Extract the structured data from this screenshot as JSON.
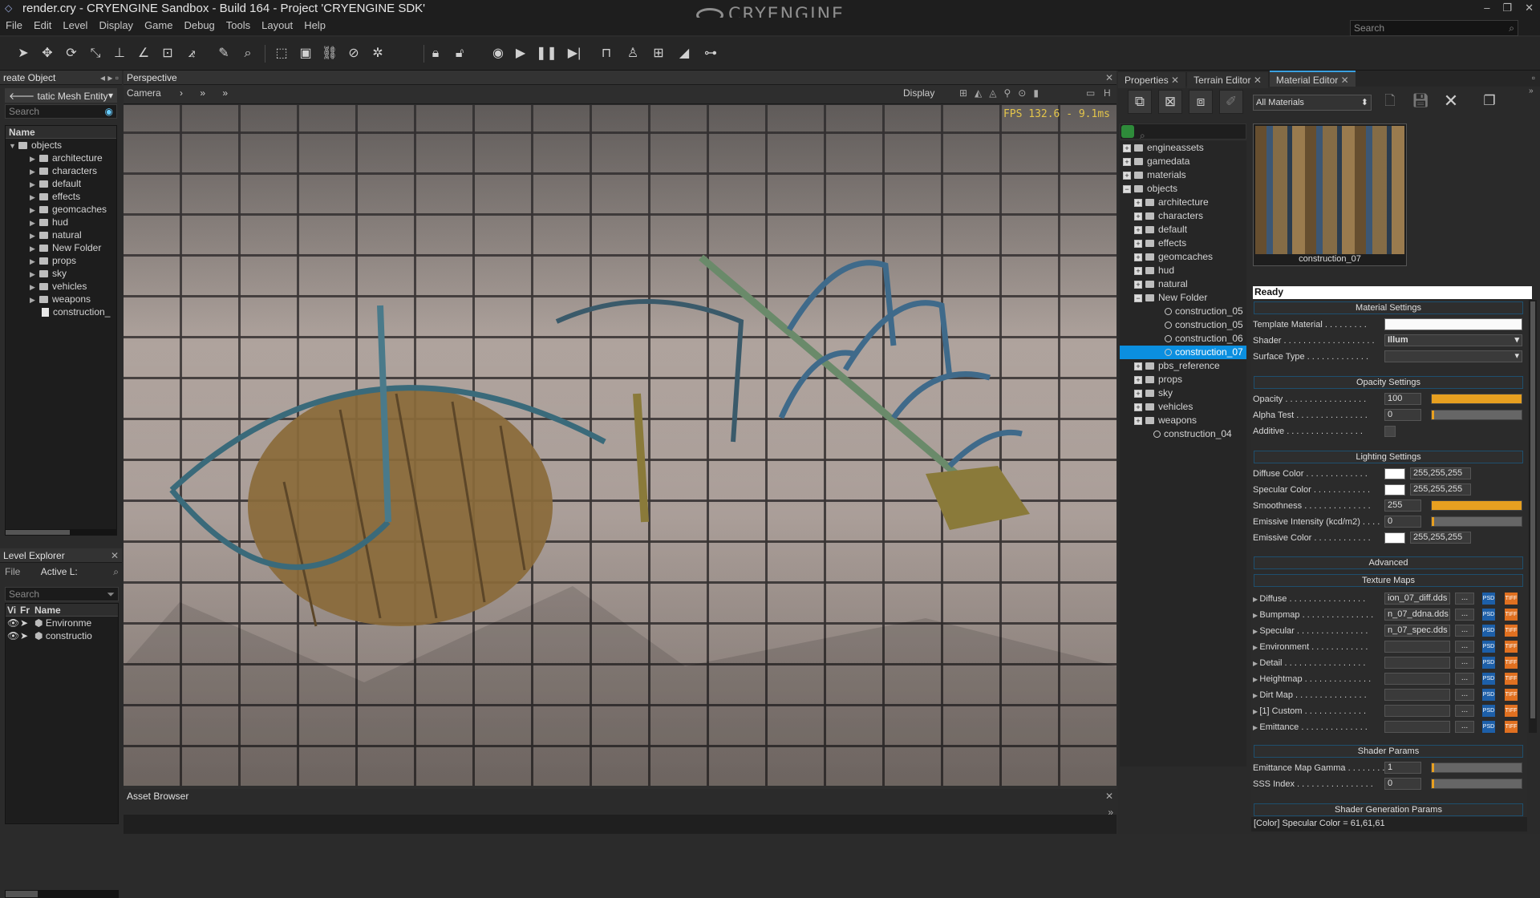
{
  "app": {
    "title": "render.cry - CRYENGINE Sandbox - Build 164 - Project 'CRYENGINE SDK'",
    "logo": "CRYENGINE",
    "search_placeholder": "Search"
  },
  "menu": [
    "File",
    "Edit",
    "Level",
    "Display",
    "Game",
    "Debug",
    "Tools",
    "Layout",
    "Help"
  ],
  "create_object": {
    "title": "reate Object",
    "entity": "tatic Mesh Entity",
    "search": "Search",
    "col": "Name",
    "root": "objects",
    "folders": [
      "architecture",
      "characters",
      "default",
      "effects",
      "geomcaches",
      "hud",
      "natural",
      "New Folder",
      "props",
      "sky",
      "vehicles",
      "weapons"
    ],
    "file": "construction_"
  },
  "level_explorer": {
    "title": "Level Explorer",
    "file_label": "File",
    "active": "Active L:",
    "search": "Search",
    "cols": [
      "Vi",
      "Fr",
      "Name"
    ],
    "rows": [
      "Environme",
      "constructio"
    ]
  },
  "viewport": {
    "title": "Perspective",
    "camera": "Camera",
    "display": "Display",
    "fps": "FPS 132.6 - 9.1ms",
    "h": "H"
  },
  "asset_browser": {
    "title": "Asset Browser"
  },
  "right_tabs": [
    "Properties",
    "Terrain Editor",
    "Material Editor"
  ],
  "material": {
    "filter": "All Materials",
    "preview_name": "construction_07",
    "status": "Ready",
    "tree_top": [
      "engineassets",
      "gamedata",
      "materials",
      "objects"
    ],
    "tree_obj": [
      "architecture",
      "characters",
      "default",
      "effects",
      "geomcaches",
      "hud",
      "natural",
      "New Folder"
    ],
    "tree_nf": [
      "construction_05",
      "construction_05",
      "construction_06",
      "construction_07"
    ],
    "tree_rest": [
      "pbs_reference",
      "props",
      "sky",
      "vehicles",
      "weapons"
    ],
    "tree_last": "construction_04",
    "groups": {
      "mat": "Material Settings",
      "op": "Opacity Settings",
      "light": "Lighting Settings",
      "adv": "Advanced",
      "tex": "Texture Maps",
      "shader": "Shader Params",
      "gen": "Shader Generation Params"
    },
    "template_label": "Template Material . . . . . . . . .",
    "shader_label": "Shader . . . . . . . . . . . . . . . . . . .",
    "shader_value": "Illum",
    "surface_label": "Surface Type . . . . . . . . . . . . .",
    "opacity_label": "Opacity . . . . . . . . . . . . . . . . .",
    "opacity": "100",
    "opacity_frac": 1.0,
    "alpha_label": "Alpha Test . . . . . . . . . . . . . . .",
    "alpha": "0",
    "alpha_frac": 0.0,
    "additive_label": "Additive . . . . . . . . . . . . . . . .",
    "diffuse_label": "Diffuse Color . . . . . . . . . . . . .",
    "diffuse": "255,255,255",
    "spec_label": "Specular Color . . . . . . . . . . . .",
    "spec": "255,255,255",
    "smooth_label": "Smoothness . . . . . . . . . . . . . .",
    "smooth": "255",
    "smooth_frac": 1.0,
    "emi_label": "Emissive Intensity (kcd/m2) . . . .",
    "emi": "0",
    "emi_frac": 0.0,
    "emic_label": "Emissive Color . . . . . . . . . . . .",
    "emic": "255,255,255",
    "tex": [
      {
        "label": "Diffuse . . . . . . . . . . . . . . . .",
        "file": "ion_07_diff.dds"
      },
      {
        "label": "Bumpmap . . . . . . . . . . . . . . .",
        "file": "n_07_ddna.dds"
      },
      {
        "label": "Specular . . . . . . . . . . . . . . .",
        "file": "n_07_spec.dds"
      },
      {
        "label": "Environment . . . . . . . . . . . .",
        "file": ""
      },
      {
        "label": "Detail . . . . . . . . . . . . . . . . .",
        "file": ""
      },
      {
        "label": "Heightmap . . . . . . . . . . . . . .",
        "file": ""
      },
      {
        "label": "Dirt Map . . . . . . . . . . . . . . .",
        "file": ""
      },
      {
        "label": "[1] Custom . . . . . . . . . . . . .",
        "file": ""
      },
      {
        "label": "Emittance . . . . . . . . . . . . . .",
        "file": ""
      }
    ],
    "dots": "...",
    "psd": "PSD",
    "tiff": "TIFF",
    "gamma_label": "Emittance Map Gamma . . . . . . . .",
    "gamma": "1",
    "sss_label": "SSS Index . . . . . . . . . . . . . . . .",
    "sss": "0",
    "bottom_status": "[Color] Specular Color = 61,61,61"
  },
  "colors": {
    "accent": "#3aa0e0",
    "selected": "#0b8fe0",
    "slider": "#e8a020"
  }
}
